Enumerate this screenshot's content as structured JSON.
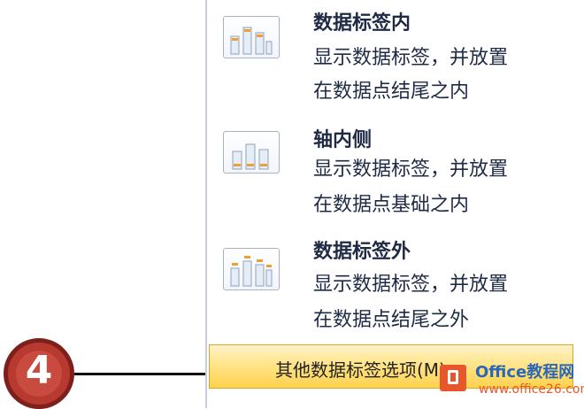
{
  "menu": {
    "items": [
      {
        "title": "数据标签内",
        "desc_line1": "显示数据标签，并放置",
        "desc_line2": "在数据点结尾之内",
        "icon": "inside-end-bar-chart-icon"
      },
      {
        "title": "轴内侧",
        "desc_line1": "显示数据标签，并放置",
        "desc_line2": "在数据点基础之内",
        "icon": "inside-base-bar-chart-icon"
      },
      {
        "title": "数据标签外",
        "desc_line1": "显示数据标签，并放置",
        "desc_line2": "在数据点结尾之外",
        "icon": "outside-end-bar-chart-icon"
      }
    ],
    "more_options_label": "其他数据标签选项(M)...",
    "highlight_color": "#ffd24d"
  },
  "annotation": {
    "step_number": "4",
    "badge_color": "#b7392f"
  },
  "watermark": {
    "brand": "Office教程网",
    "url": "www.office26.com",
    "logo_color": "#e8572b"
  }
}
